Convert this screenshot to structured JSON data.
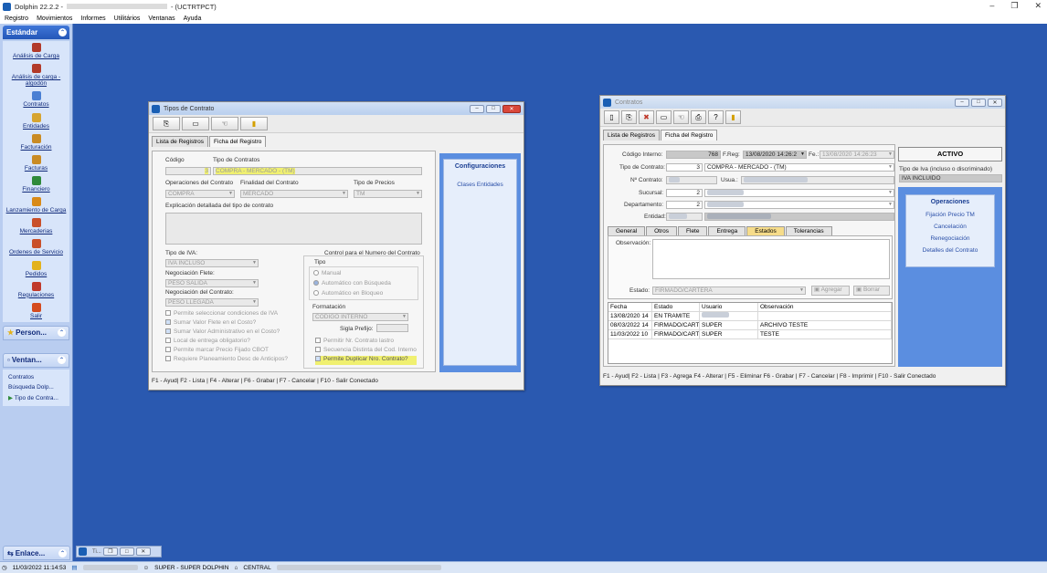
{
  "app": {
    "title": "Dolphin 22.2.2 -",
    "title_suffix": "- (UCTRTPCT)",
    "window_controls": [
      "–",
      "❐",
      "✕"
    ]
  },
  "menu": [
    "Registro",
    "Movimientos",
    "Informes",
    "Utilitários",
    "Ventanas",
    "Ayuda"
  ],
  "sidebar": {
    "estandar_label": "Estándar",
    "items": [
      {
        "label": "Análisis de Carga",
        "icon": "bottle-icon",
        "color": "#b23a2a"
      },
      {
        "label": "Análisis de carga - algodón",
        "icon": "bottle-icon",
        "color": "#b23a2a"
      },
      {
        "label": "Contratos",
        "icon": "contract-icon",
        "color": "#4a7fd3"
      },
      {
        "label": "Entidades",
        "icon": "people-icon",
        "color": "#d6a431"
      },
      {
        "label": "Facturación",
        "icon": "money-bag-icon",
        "color": "#c98b24"
      },
      {
        "label": "Facturas",
        "icon": "money-bag-icon",
        "color": "#c98b24"
      },
      {
        "label": "Financiero",
        "icon": "money-bag-icon",
        "color": "#2f8a3a"
      },
      {
        "label": "Lanzamiento de Carga",
        "icon": "truck-icon",
        "color": "#d98a18"
      },
      {
        "label": "Mercaderias",
        "icon": "box-icon",
        "color": "#c9502a"
      },
      {
        "label": "Ordenes de Servicio",
        "icon": "clipboard-icon",
        "color": "#c9502a"
      },
      {
        "label": "Pedidos",
        "icon": "star-icon",
        "color": "#e3b21c"
      },
      {
        "label": "Regulaciones",
        "icon": "check-icon",
        "color": "#c0392b"
      },
      {
        "label": "Salir",
        "icon": "exit-icon",
        "color": "#d44a1e"
      }
    ],
    "person_label": "Person...",
    "ventan_label": "Ventan...",
    "ventan_items": [
      "Contratos",
      "Búsqueda Dolp...",
      "Tipo de Contra..."
    ],
    "enlace_label": "Enlace..."
  },
  "tipos_win": {
    "title": "Tipos de Contrato",
    "tabs": [
      "Lista de Registros",
      "Ficha del Registro"
    ],
    "codigo_label": "Código",
    "codigo_value": "3",
    "tipo_label": "Tipo de Contratos",
    "tipo_value": "COMPRA - MERCADO - (TM)",
    "op_label": "Operaciones del Contrato",
    "op_value": "COMPRA",
    "fin_label": "Finalidad del Contrato",
    "fin_value": "MERCADO",
    "precio_label": "Tipo de Precios",
    "precio_value": "TM",
    "expl_label": "Explicación detallada del tipo de contrato",
    "iva_label": "Tipo de IVA:",
    "iva_value": "IVA INCLUSO",
    "flete_label": "Negociación Flete:",
    "flete_value": "PESO SALIDA",
    "neg_label": "Negociación del Contrato:",
    "neg_value": "PESO LLEGADA",
    "checks": [
      {
        "label": "Permite seleccionar condiciones de IVA",
        "on": false
      },
      {
        "label": "Sumar Valor Flete en el Costo?",
        "on": true
      },
      {
        "label": "Sumar Valor Administrativo en el Costo?",
        "on": true
      },
      {
        "label": "Local de entrega obligatorio?",
        "on": false
      },
      {
        "label": "Permite marcar Precio Fijado CBOT",
        "on": false
      },
      {
        "label": "Requiere Planeamiento Desc de Anticipos?",
        "on": false
      }
    ],
    "control_label": "Control para el Numero del Contrato",
    "tipo_sub": "Tipo",
    "radios": [
      "Manual",
      "Automático con Búsqueda",
      "Automático en Bloqueo"
    ],
    "formatacion_label": "Formatación",
    "formatacion_value": "CÓDIGO INTERNO",
    "sigla_label": "Sigla Prefijo:",
    "right_checks": [
      {
        "label": "Permitir Nr. Contrato lastro",
        "on": false
      },
      {
        "label": "Secuencia Distinta del Cod. Interno",
        "on": false
      },
      {
        "label": "Permite Duplicar Nro. Contrato?",
        "on": true
      }
    ],
    "config_title": "Configuraciones",
    "config_link": "Clases Entidades",
    "status": "F1 - Ayud| F2 - Lista | F4 - Alterar | F6 - Grabar | F7 - Cancelar | F10 - Salir Conectado"
  },
  "contratos_win": {
    "title": "Contratos",
    "tabs": [
      "Lista de Registros",
      "Ficha del Registro"
    ],
    "codigo_label": "Código Interno:",
    "codigo_value": "768",
    "freg_label": "F.Reg:",
    "freg_value": "13/08/2020 14:26:2",
    "fe_label": "Fe.:",
    "fe_value": "13/08/2020 14:26:23",
    "estado_badge": "ACTIVO",
    "tipo_label": "Tipo de Contrato:",
    "tipo_code": "3",
    "tipo_value": "COMPRA - MERCADO - (TM)",
    "iva_label": "Tipo de Iva (incluso o discriminado)",
    "iva_value": "IVA INCLUIDO",
    "nro_label": "Nº Contrato:",
    "usua_label": "Usua.:",
    "sucursal_label": "Sucursal:",
    "sucursal_value": "2",
    "depto_label": "Departamento:",
    "depto_value": "2",
    "entidad_label": "Entidad:",
    "subtabs": [
      "General",
      "Otros",
      "Flete",
      "Entrega",
      "Estados",
      "Tolerancias"
    ],
    "obs_label": "Observación:",
    "estado_label": "Estado:",
    "estado_value": "FIRMADO/CARTERA",
    "agregar": "Agregar",
    "borrar": "Borrar",
    "ops_title": "Operaciones",
    "ops": [
      "Fijación Precio TM",
      "Cancelación",
      "Renegociación",
      "Detalles del Contrato"
    ],
    "grid_headers": [
      "Fecha",
      "Estado",
      "Usuario",
      "Observación"
    ],
    "grid_rows": [
      [
        "13/08/2020 14",
        "EN TRAMITE",
        "",
        ""
      ],
      [
        "08/03/2022 14",
        "FIRMADO/CART",
        "SUPER",
        "ARCHIVO TESTE"
      ],
      [
        "11/03/2022 10",
        "FIRMADO/CART",
        "SUPER",
        "TESTE"
      ]
    ],
    "status": "F1 - Ayud| F2 - Lista | F3 - Agrega F4 - Alterar | F5 - Eliminar F6 - Grabar | F7 - Cancelar | F8 - Imprimir | F10 - Salir Conectado"
  },
  "taskbar": {
    "datetime": "11/03/2022 11:14:53",
    "user": "SUPER - SUPER DOLPHIN",
    "branch": "CENTRAL",
    "mini": "Ti..."
  }
}
